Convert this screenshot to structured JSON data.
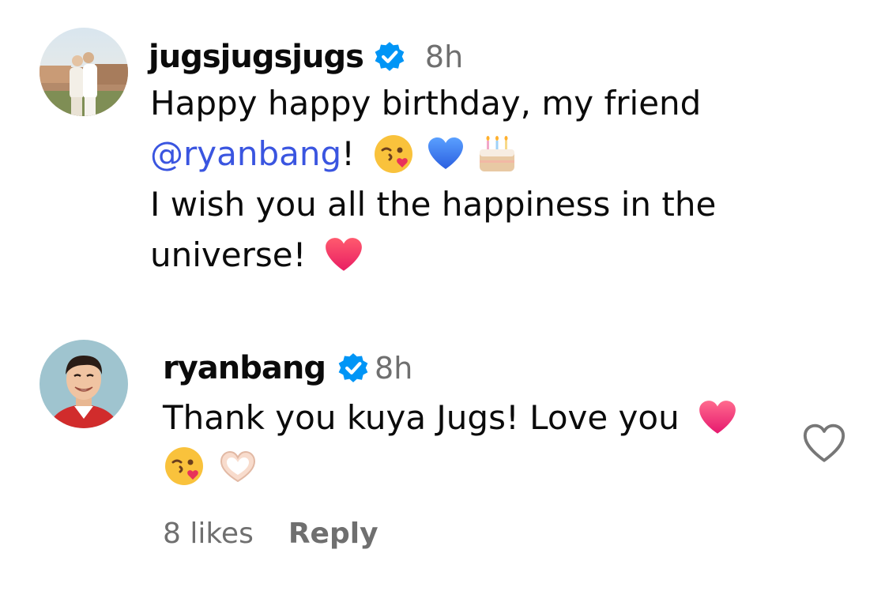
{
  "comments": [
    {
      "username": "jugsjugsjugs",
      "time": "8h",
      "line1": "Happy happy birthday, my friend",
      "mention": "@ryanbang",
      "after_mention": "!",
      "line3": "I wish you all the happiness in the",
      "line4": "universe!",
      "emojis": [
        "kissing-face-icon",
        "blue-heart-icon",
        "birthday-cake-icon",
        "red-heart-icon"
      ]
    },
    {
      "username": "ryanbang",
      "time": "8h",
      "line1": "Thank you kuya Jugs! Love you",
      "emojis": [
        "pink-heart-icon",
        "kissing-face-icon",
        "heart-hands-icon"
      ],
      "likes": "8 likes",
      "reply_label": "Reply"
    }
  ],
  "colors": {
    "verified": "#0095f6",
    "mention": "#3a55e0",
    "meta_text": "#6f6f6f"
  }
}
